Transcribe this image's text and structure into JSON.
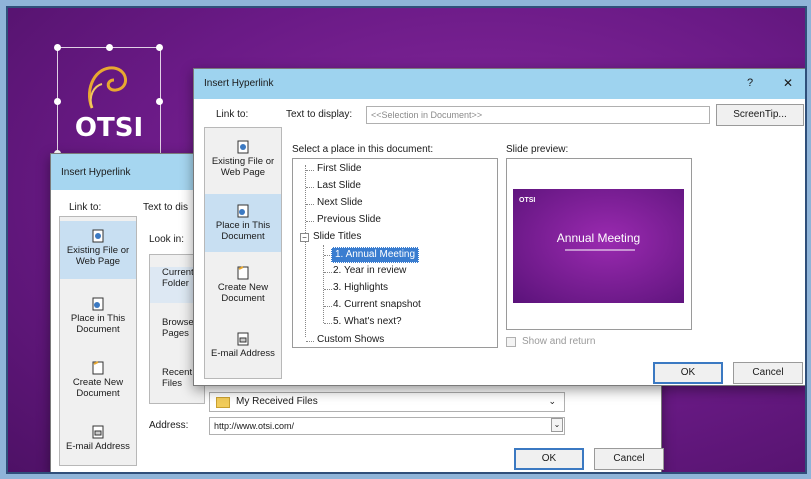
{
  "logo": {
    "text": "OTSI"
  },
  "back_dialog": {
    "title": "Insert Hyperlink",
    "link_to_label": "Link to:",
    "text_to_display_label": "Text to dis",
    "look_in_label": "Look in:",
    "link_items": [
      {
        "label": "Existing File or Web Page",
        "icon": "web-page-icon"
      },
      {
        "label": "Place in This Document",
        "icon": "document-place-icon"
      },
      {
        "label": "Create New Document",
        "icon": "new-document-icon"
      },
      {
        "label": "E-mail Address",
        "icon": "email-icon"
      }
    ],
    "nav_items": [
      "Current Folder",
      "Browsed Pages",
      "Recent Files"
    ],
    "file_list_item": "My Received Files",
    "address_label": "Address:",
    "address_value": "http://www.otsi.com/",
    "ok_label": "OK",
    "cancel_label": "Cancel"
  },
  "front_dialog": {
    "title": "Insert Hyperlink",
    "help_label": "?",
    "close_label": "✕",
    "link_to_label": "Link to:",
    "text_to_display_label": "Text to display:",
    "text_to_display_value": "<<Selection in Document>>",
    "screentip_label": "ScreenTip...",
    "link_items": [
      {
        "label": "Existing File or Web Page",
        "icon": "web-page-icon"
      },
      {
        "label": "Place in This Document",
        "icon": "document-place-icon",
        "selected": true
      },
      {
        "label": "Create New Document",
        "icon": "new-document-icon"
      },
      {
        "label": "E-mail Address",
        "icon": "email-icon"
      }
    ],
    "select_place_label": "Select a place in this document:",
    "tree": {
      "top": [
        "First Slide",
        "Last Slide",
        "Next Slide",
        "Previous Slide"
      ],
      "slide_titles_label": "Slide Titles",
      "slides": [
        "1. Annual Meeting",
        "2. Year in review",
        "3. Highlights",
        "4. Current snapshot",
        "5. What's next?"
      ],
      "selected_slide": "1. Annual Meeting",
      "custom_shows": "Custom Shows"
    },
    "slide_preview_label": "Slide preview:",
    "preview": {
      "slide_title": "Annual Meeting",
      "slide_logo": "OTSI"
    },
    "show_and_return_label": "Show and return",
    "ok_label": "OK",
    "cancel_label": "Cancel"
  },
  "colors": {
    "background": "#6a1a86",
    "titlebar": "#9ed3ef",
    "selection": "#3a7dd0"
  }
}
